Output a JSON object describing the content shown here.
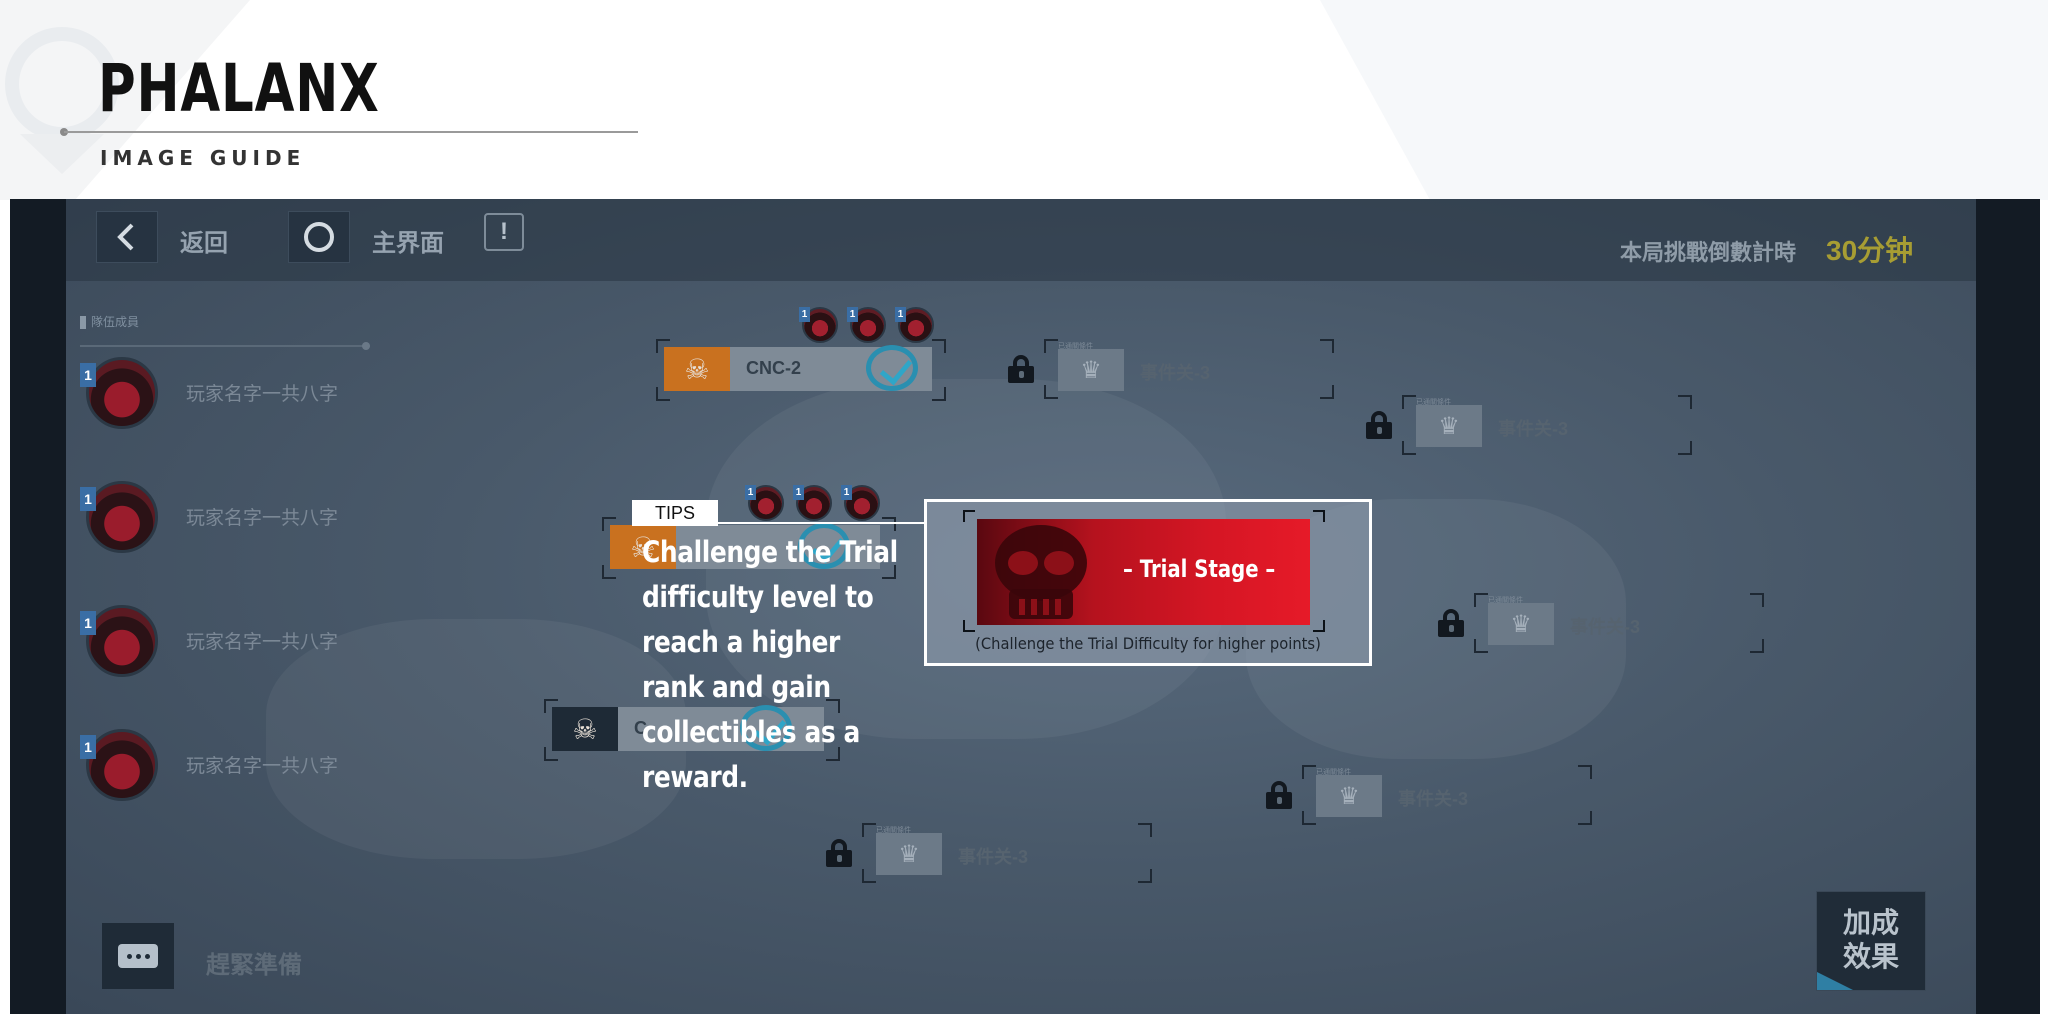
{
  "header": {
    "brand": "PHALANX",
    "subtitle": "IMAGE GUIDE"
  },
  "topbar": {
    "back_label": "返回",
    "home_label": "主界面",
    "info_glyph": "!",
    "timer_label": "本局挑戰倒數計時",
    "timer_value": "30分钟"
  },
  "player_list": {
    "title": "隊伍成員",
    "players": [
      {
        "rank": "1",
        "name": "玩家名字一共八字"
      },
      {
        "rank": "1",
        "name": "玩家名字一共八字"
      },
      {
        "rank": "1",
        "name": "玩家名字一共八字"
      },
      {
        "rank": "1",
        "name": "玩家名字一共八字"
      }
    ]
  },
  "stages": [
    {
      "label": "CNC-2",
      "ranks": [
        "1",
        "1",
        "1"
      ]
    },
    {
      "label": "",
      "ranks": [
        "1",
        "1",
        "1"
      ]
    },
    {
      "label": "C",
      "ranks": []
    }
  ],
  "events": [
    {
      "name": "事件关-3",
      "caption": "已通關條件"
    },
    {
      "name": "事件关-3",
      "caption": "已通關條件"
    },
    {
      "name": "事件关-3",
      "caption": "已通關條件"
    },
    {
      "name": "事件关-3",
      "caption": "已通關條件"
    },
    {
      "name": "事件关-3",
      "caption": "已通關條件"
    }
  ],
  "bottom": {
    "chat_label": "趕緊準備",
    "bonus_label_1": "加成",
    "bonus_label_2": "效果"
  },
  "callout": {
    "tag": "TIPS",
    "tip_text": "Challenge the Trial difficulty level to reach a higher rank and gain collectibles as a reward.",
    "banner_title": "– Trial Stage –",
    "caption": "(Challenge the Trial Difficulty for higher points)"
  },
  "colors": {
    "timer_accent": "#a79d33",
    "banner_red": "#d51624",
    "check_blue": "#2a8fb0",
    "stage_orange": "#c9711f"
  },
  "icons": [
    "back-arrow-icon",
    "home-circle-icon",
    "info-icon",
    "lock-icon",
    "crown-icon",
    "skull-icon",
    "check-icon",
    "chat-icon"
  ]
}
